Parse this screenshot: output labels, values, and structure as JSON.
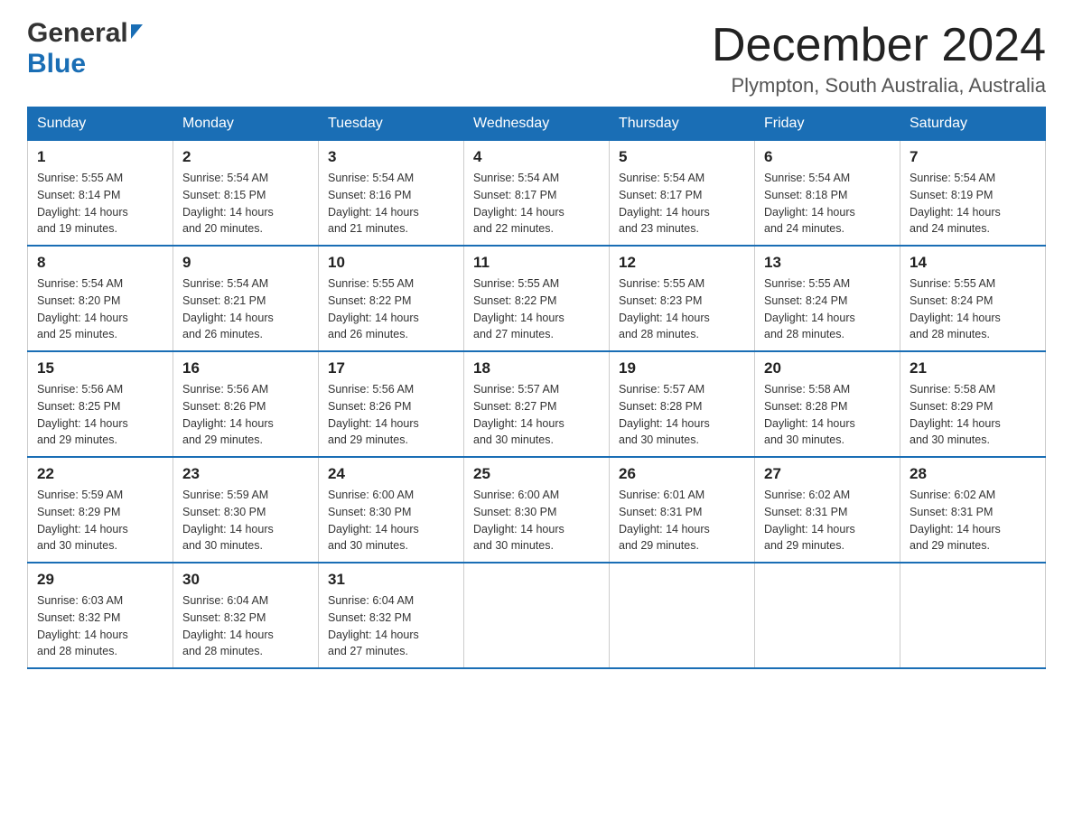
{
  "header": {
    "logo": {
      "general": "General",
      "blue": "Blue"
    },
    "title": "December 2024",
    "location": "Plympton, South Australia, Australia"
  },
  "calendar": {
    "weekdays": [
      "Sunday",
      "Monday",
      "Tuesday",
      "Wednesday",
      "Thursday",
      "Friday",
      "Saturday"
    ],
    "weeks": [
      [
        {
          "day": "1",
          "info": "Sunrise: 5:55 AM\nSunset: 8:14 PM\nDaylight: 14 hours\nand 19 minutes."
        },
        {
          "day": "2",
          "info": "Sunrise: 5:54 AM\nSunset: 8:15 PM\nDaylight: 14 hours\nand 20 minutes."
        },
        {
          "day": "3",
          "info": "Sunrise: 5:54 AM\nSunset: 8:16 PM\nDaylight: 14 hours\nand 21 minutes."
        },
        {
          "day": "4",
          "info": "Sunrise: 5:54 AM\nSunset: 8:17 PM\nDaylight: 14 hours\nand 22 minutes."
        },
        {
          "day": "5",
          "info": "Sunrise: 5:54 AM\nSunset: 8:17 PM\nDaylight: 14 hours\nand 23 minutes."
        },
        {
          "day": "6",
          "info": "Sunrise: 5:54 AM\nSunset: 8:18 PM\nDaylight: 14 hours\nand 24 minutes."
        },
        {
          "day": "7",
          "info": "Sunrise: 5:54 AM\nSunset: 8:19 PM\nDaylight: 14 hours\nand 24 minutes."
        }
      ],
      [
        {
          "day": "8",
          "info": "Sunrise: 5:54 AM\nSunset: 8:20 PM\nDaylight: 14 hours\nand 25 minutes."
        },
        {
          "day": "9",
          "info": "Sunrise: 5:54 AM\nSunset: 8:21 PM\nDaylight: 14 hours\nand 26 minutes."
        },
        {
          "day": "10",
          "info": "Sunrise: 5:55 AM\nSunset: 8:22 PM\nDaylight: 14 hours\nand 26 minutes."
        },
        {
          "day": "11",
          "info": "Sunrise: 5:55 AM\nSunset: 8:22 PM\nDaylight: 14 hours\nand 27 minutes."
        },
        {
          "day": "12",
          "info": "Sunrise: 5:55 AM\nSunset: 8:23 PM\nDaylight: 14 hours\nand 28 minutes."
        },
        {
          "day": "13",
          "info": "Sunrise: 5:55 AM\nSunset: 8:24 PM\nDaylight: 14 hours\nand 28 minutes."
        },
        {
          "day": "14",
          "info": "Sunrise: 5:55 AM\nSunset: 8:24 PM\nDaylight: 14 hours\nand 28 minutes."
        }
      ],
      [
        {
          "day": "15",
          "info": "Sunrise: 5:56 AM\nSunset: 8:25 PM\nDaylight: 14 hours\nand 29 minutes."
        },
        {
          "day": "16",
          "info": "Sunrise: 5:56 AM\nSunset: 8:26 PM\nDaylight: 14 hours\nand 29 minutes."
        },
        {
          "day": "17",
          "info": "Sunrise: 5:56 AM\nSunset: 8:26 PM\nDaylight: 14 hours\nand 29 minutes."
        },
        {
          "day": "18",
          "info": "Sunrise: 5:57 AM\nSunset: 8:27 PM\nDaylight: 14 hours\nand 30 minutes."
        },
        {
          "day": "19",
          "info": "Sunrise: 5:57 AM\nSunset: 8:28 PM\nDaylight: 14 hours\nand 30 minutes."
        },
        {
          "day": "20",
          "info": "Sunrise: 5:58 AM\nSunset: 8:28 PM\nDaylight: 14 hours\nand 30 minutes."
        },
        {
          "day": "21",
          "info": "Sunrise: 5:58 AM\nSunset: 8:29 PM\nDaylight: 14 hours\nand 30 minutes."
        }
      ],
      [
        {
          "day": "22",
          "info": "Sunrise: 5:59 AM\nSunset: 8:29 PM\nDaylight: 14 hours\nand 30 minutes."
        },
        {
          "day": "23",
          "info": "Sunrise: 5:59 AM\nSunset: 8:30 PM\nDaylight: 14 hours\nand 30 minutes."
        },
        {
          "day": "24",
          "info": "Sunrise: 6:00 AM\nSunset: 8:30 PM\nDaylight: 14 hours\nand 30 minutes."
        },
        {
          "day": "25",
          "info": "Sunrise: 6:00 AM\nSunset: 8:30 PM\nDaylight: 14 hours\nand 30 minutes."
        },
        {
          "day": "26",
          "info": "Sunrise: 6:01 AM\nSunset: 8:31 PM\nDaylight: 14 hours\nand 29 minutes."
        },
        {
          "day": "27",
          "info": "Sunrise: 6:02 AM\nSunset: 8:31 PM\nDaylight: 14 hours\nand 29 minutes."
        },
        {
          "day": "28",
          "info": "Sunrise: 6:02 AM\nSunset: 8:31 PM\nDaylight: 14 hours\nand 29 minutes."
        }
      ],
      [
        {
          "day": "29",
          "info": "Sunrise: 6:03 AM\nSunset: 8:32 PM\nDaylight: 14 hours\nand 28 minutes."
        },
        {
          "day": "30",
          "info": "Sunrise: 6:04 AM\nSunset: 8:32 PM\nDaylight: 14 hours\nand 28 minutes."
        },
        {
          "day": "31",
          "info": "Sunrise: 6:04 AM\nSunset: 8:32 PM\nDaylight: 14 hours\nand 27 minutes."
        },
        {
          "day": "",
          "info": ""
        },
        {
          "day": "",
          "info": ""
        },
        {
          "day": "",
          "info": ""
        },
        {
          "day": "",
          "info": ""
        }
      ]
    ]
  }
}
